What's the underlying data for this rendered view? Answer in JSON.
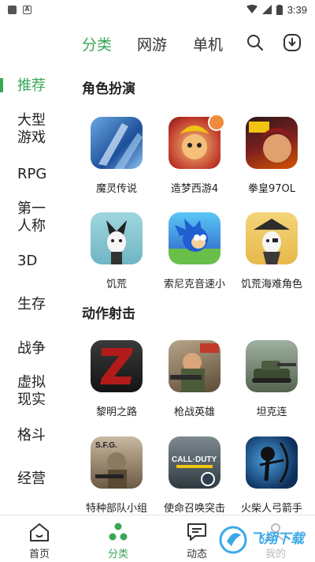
{
  "status_bar": {
    "time": "3:39"
  },
  "top_tabs": [
    {
      "label": "分类"
    },
    {
      "label": "网游"
    },
    {
      "label": "单机"
    }
  ],
  "sidebar": {
    "items": [
      {
        "label": "推荐"
      },
      {
        "label": "大型游戏"
      },
      {
        "label": "RPG"
      },
      {
        "label": "第一人称"
      },
      {
        "label": "3D"
      },
      {
        "label": "生存"
      },
      {
        "label": "战争"
      },
      {
        "label": "虚拟现实"
      },
      {
        "label": "格斗"
      },
      {
        "label": "经营"
      }
    ]
  },
  "sections": [
    {
      "title": "角色扮演",
      "games": [
        {
          "name": "魔灵传说",
          "icon": "magic-legend-icon"
        },
        {
          "name": "造梦西游4",
          "icon": "dream-journey-icon"
        },
        {
          "name": "拳皇97OL",
          "icon": "kof97-icon"
        },
        {
          "name": "饥荒",
          "icon": "dont-starve-icon"
        },
        {
          "name": "索尼克音速小",
          "icon": "sonic-icon"
        },
        {
          "name": "饥荒海难角色",
          "icon": "shipwrecked-icon"
        }
      ]
    },
    {
      "title": "动作射击",
      "games": [
        {
          "name": "黎明之路",
          "icon": "dawn-road-icon"
        },
        {
          "name": "枪战英雄",
          "icon": "gun-hero-icon"
        },
        {
          "name": "坦克连",
          "icon": "tank-icon"
        },
        {
          "name": "特种部队小组",
          "icon": "special-forces-icon"
        },
        {
          "name": "使命召唤突击",
          "icon": "call-of-duty-icon"
        },
        {
          "name": "火柴人弓箭手",
          "icon": "stickman-archer-icon"
        }
      ]
    }
  ],
  "bottom_nav": [
    {
      "label": "首页",
      "icon": "home-icon"
    },
    {
      "label": "分类",
      "icon": "category-icon"
    },
    {
      "label": "动态",
      "icon": "message-icon"
    },
    {
      "label": "我的",
      "icon": "profile-icon"
    }
  ],
  "watermark": {
    "text": "飞翔下载"
  },
  "colors": {
    "accent": "#3aa757",
    "text": "#222222"
  }
}
